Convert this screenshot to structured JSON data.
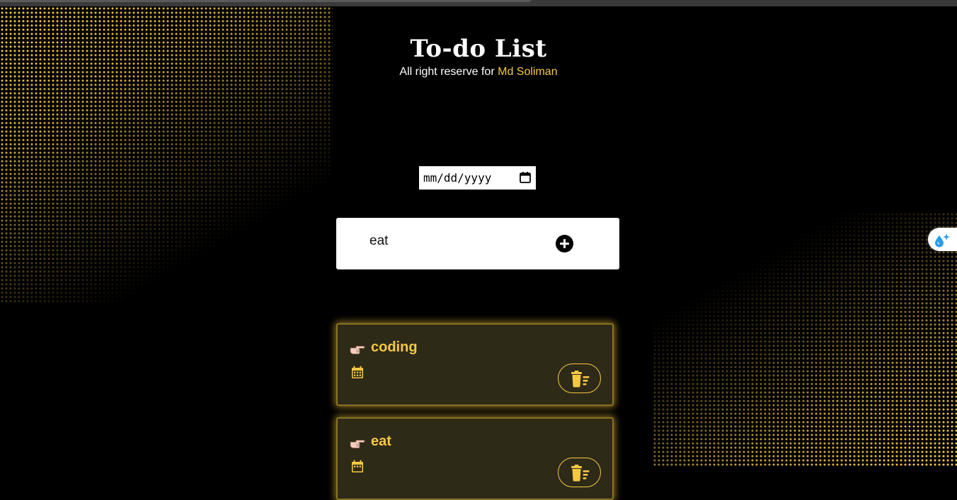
{
  "header": {
    "title": "To-do List",
    "subtitle_prefix": "All right reserve for ",
    "author": "Md Soliman"
  },
  "date_input": {
    "placeholder": "mm/dd/yyyy"
  },
  "task_input": {
    "value": "eat"
  },
  "tasks": [
    {
      "name": "coding"
    },
    {
      "name": "eat"
    }
  ],
  "colors": {
    "background": "#000000",
    "accent": "#f5c842",
    "card_background": "#2e2a18"
  },
  "icons": {
    "add": "plus-circle-icon",
    "task_bullet": "pointing-hand-icon",
    "task_date": "calendar-icon",
    "task_delete": "trash-icon",
    "side_widget": "water-drop-sparkle-icon"
  }
}
